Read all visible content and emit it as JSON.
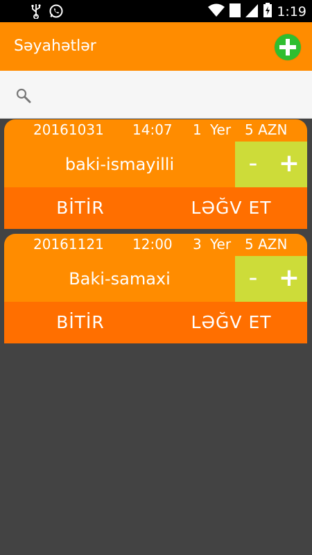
{
  "status_bar": {
    "time": "1:19",
    "sim_badge": "1",
    "icons": [
      "usb-icon",
      "whatsapp-icon",
      "wifi-icon",
      "signal-icon",
      "battery-icon"
    ]
  },
  "app_bar": {
    "title": "Səyahətlər",
    "add_icon": "plus-circle-icon",
    "accent_color": "#ff8c00",
    "add_color": "#2fbe2f"
  },
  "search": {
    "icon": "search-icon",
    "value": "",
    "placeholder": ""
  },
  "trips": [
    {
      "date": "20161031",
      "time": "14:07",
      "seats": "1",
      "seat_label": "Yer",
      "price": "5 AZN",
      "route": "baki-ismayilli",
      "minus_label": "-",
      "plus_label": "+",
      "finish_label": "BİTİR",
      "cancel_label": "LƏĞV ET"
    },
    {
      "date": "20161121",
      "time": "12:00",
      "seats": "3",
      "seat_label": "Yer",
      "price": "5 AZN",
      "route": "Baki-samaxi",
      "minus_label": "-",
      "plus_label": "+",
      "finish_label": "BİTİR",
      "cancel_label": "LƏĞV ET"
    }
  ],
  "colors": {
    "card": "#ff8c00",
    "card_actions": "#ff6f00",
    "stepper": "#cddc39",
    "background": "#434343"
  }
}
